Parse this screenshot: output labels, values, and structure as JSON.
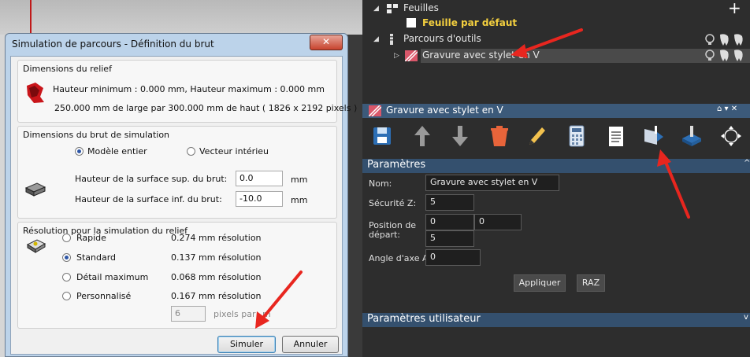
{
  "dialog": {
    "title": "Simulation de parcours - Définition du brut",
    "close_label": "✕",
    "relief": {
      "heading": "Dimensions du relief",
      "line1": "Hauteur minimum : 0.000 mm, Hauteur maximum : 0.000 mm",
      "line2": "250.000 mm de large par 300.000 mm de haut ( 1826 x 2192 pixels )"
    },
    "block": {
      "heading": "Dimensions du brut de simulation",
      "option_whole": "Modèle entier",
      "option_vector": "Vecteur intérieu",
      "top_label": "Hauteur de la surface sup. du brut:",
      "top_value": "0.0",
      "bottom_label": "Hauteur de la surface inf. du brut:",
      "bottom_value": "-10.0",
      "unit": "mm"
    },
    "resolution": {
      "heading": "Résolution pour la simulation du relief",
      "options": [
        {
          "label": "Rapide",
          "value": "0.274 mm résolution",
          "selected": false
        },
        {
          "label": "Standard",
          "value": "0.137 mm résolution",
          "selected": true
        },
        {
          "label": "Détail maximum",
          "value": "0.068 mm résolution",
          "selected": false
        },
        {
          "label": "Personnalisé",
          "value": "0.167 mm résolution",
          "selected": false
        }
      ],
      "custom_pixels": "6",
      "pixels_per": "pixels par",
      "trailing": "m"
    },
    "simulate_label": "Simuler",
    "cancel_label": "Annuler"
  },
  "tree": {
    "sheets": "Feuilles",
    "default_sheet": "Feuille par défaut",
    "toolpaths": "Parcours d'outils",
    "toolpath_item": "Gravure avec stylet en V",
    "plus": "+"
  },
  "panel": {
    "title": "Gravure avec stylet en V",
    "params_heading": "Paramètres",
    "name_label": "Nom:",
    "name_value": "Gravure avec stylet en V",
    "safety_label": "Sécurité Z:",
    "safety_value": "5",
    "start_label_1": "Position de",
    "start_label_2": "départ:",
    "start_x": "0",
    "start_y": "0",
    "start_z": "5",
    "angle_label": "Angle d'axe A:",
    "angle_value": "0",
    "apply_label": "Appliquer",
    "reset_label": "RAZ",
    "user_params_heading": "Paramètres utilisateur"
  },
  "colors": {
    "accent_red": "#e8261f",
    "panel_blue": "#3c5a7a"
  }
}
